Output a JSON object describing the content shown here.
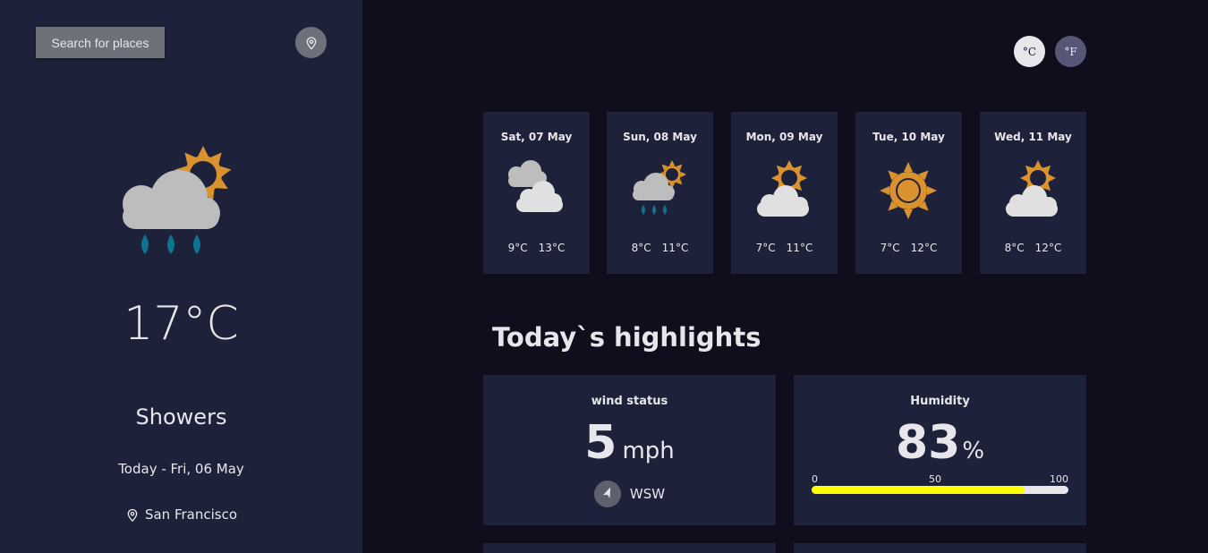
{
  "sidebar": {
    "search_label": "Search for places",
    "current_icon": "showers-sun-icon",
    "temperature": "17°C",
    "condition": "Showers",
    "date": "Today - Fri, 06 May",
    "location": "San Francisco"
  },
  "units": {
    "celsius": "°C",
    "fahrenheit": "°F"
  },
  "forecast": [
    {
      "day": "Sat, 07 May",
      "icon": "heavy-cloud-icon",
      "min": "9°C",
      "max": "13°C"
    },
    {
      "day": "Sun, 08 May",
      "icon": "showers-icon",
      "min": "8°C",
      "max": "11°C"
    },
    {
      "day": "Mon, 09 May",
      "icon": "light-cloud-icon",
      "min": "7°C",
      "max": "11°C"
    },
    {
      "day": "Tue, 10 May",
      "icon": "clear-icon",
      "min": "7°C",
      "max": "12°C"
    },
    {
      "day": "Wed, 11 May",
      "icon": "light-cloud-icon",
      "min": "8°C",
      "max": "12°C"
    }
  ],
  "highlights": {
    "title": "Today`s highlights",
    "wind": {
      "label": "wind status",
      "value": "5",
      "unit": "mph",
      "direction": "WSW"
    },
    "humidity": {
      "label": "Humidity",
      "value": "83",
      "unit": "%",
      "scale": [
        "0",
        "50",
        "100"
      ],
      "fraction": 0.83
    }
  },
  "colors": {
    "sidebar": "#1e213a",
    "background": "#100e1d",
    "bar_fill": "#ffff00",
    "sun": "#d9922e",
    "rain": "#0e7490"
  }
}
